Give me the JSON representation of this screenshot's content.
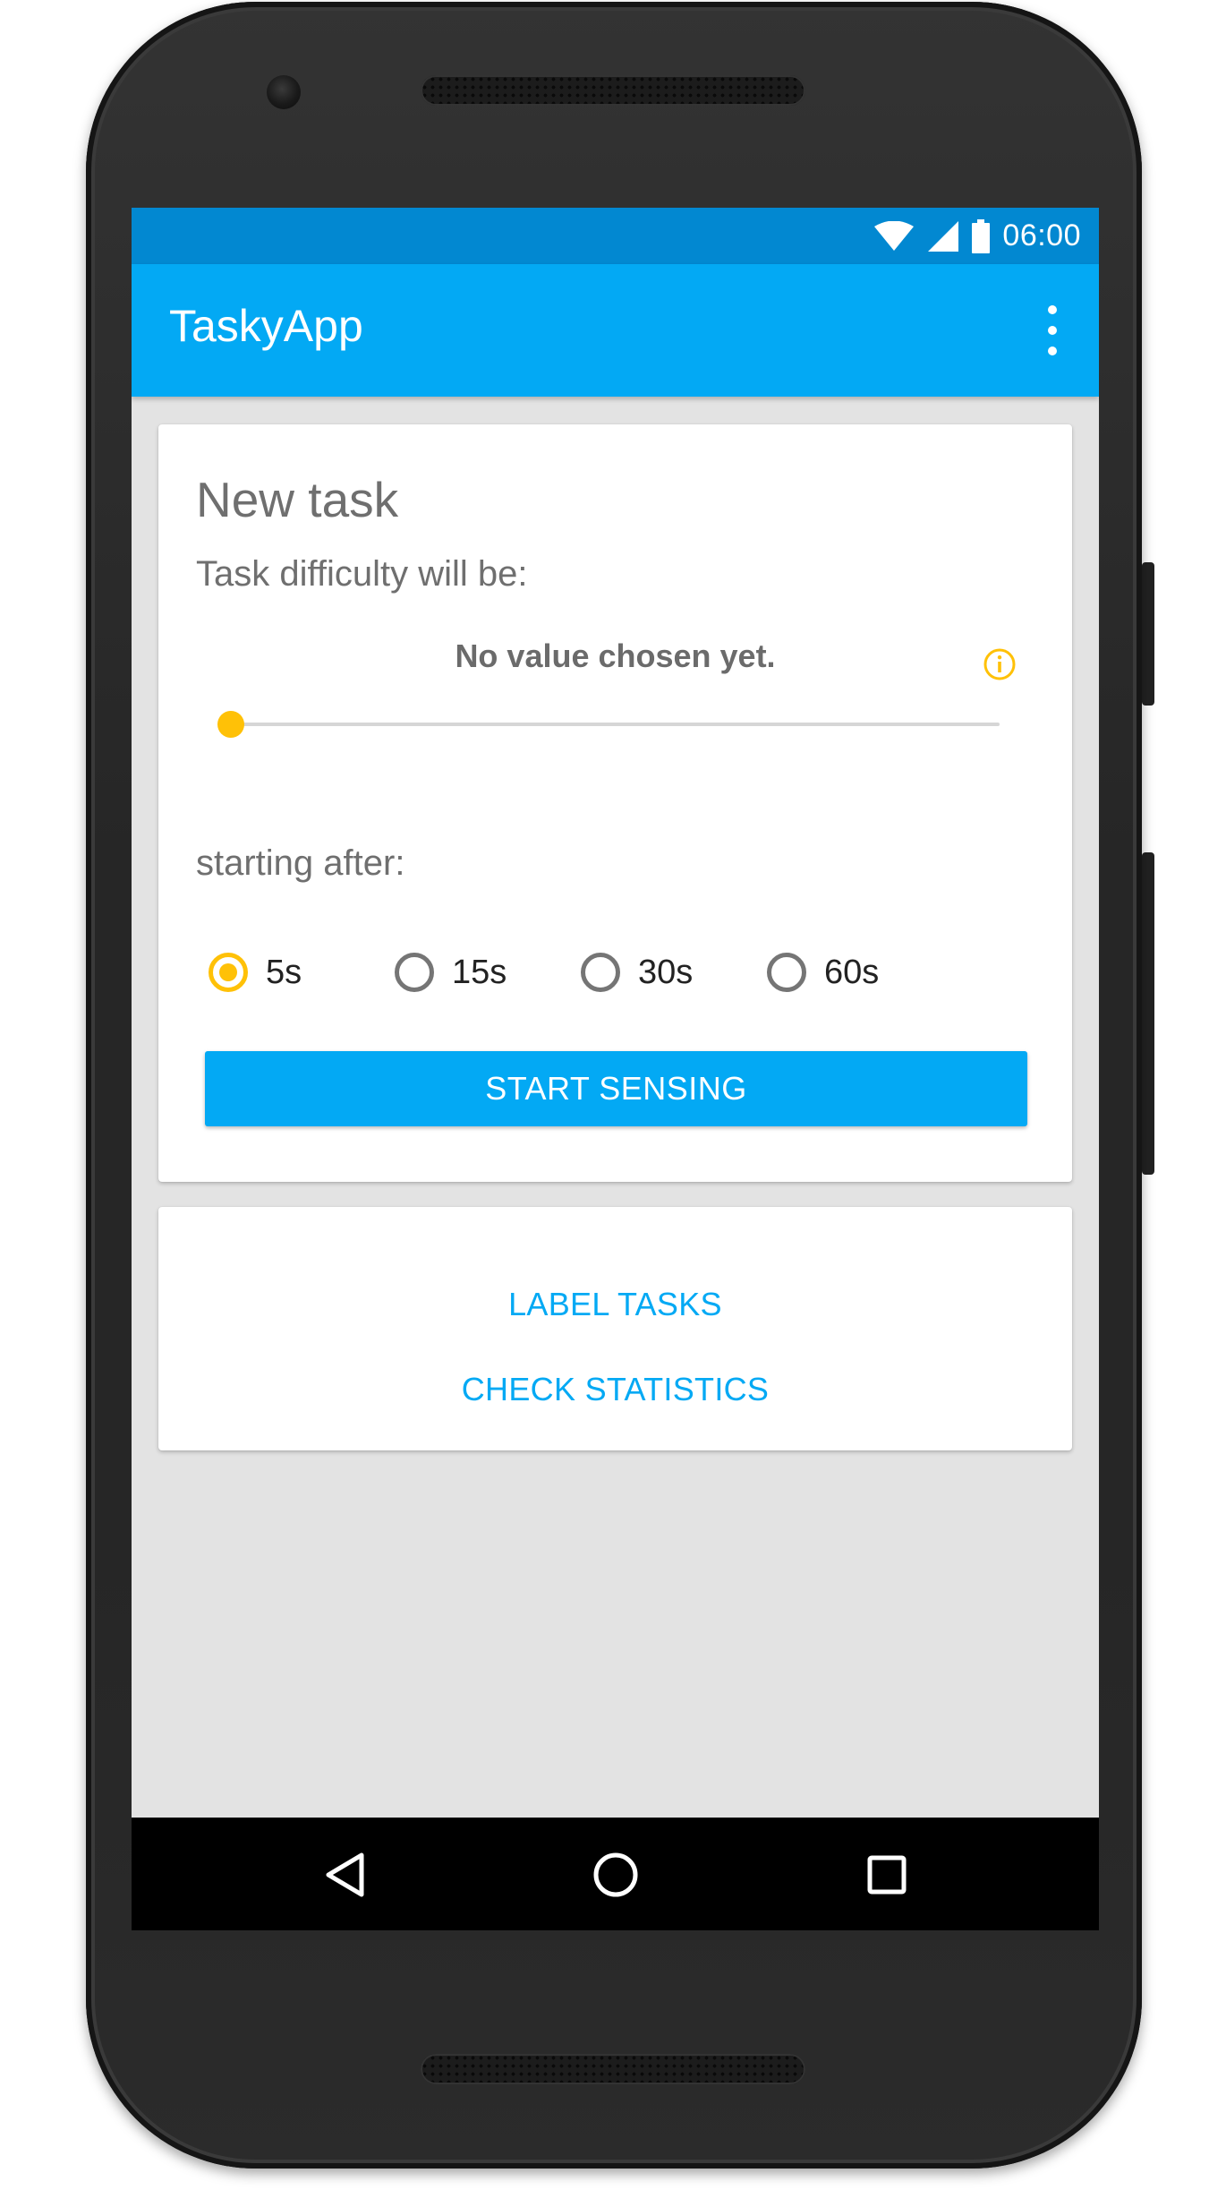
{
  "status_bar": {
    "time": "06:00",
    "icons": [
      "wifi-icon",
      "cell-signal-icon",
      "battery-icon"
    ]
  },
  "app_bar": {
    "title": "TaskyApp",
    "menu_icon": "more-vert-icon"
  },
  "task_card": {
    "title": "New task",
    "difficulty_label": "Task difficulty will be:",
    "difficulty_value": "No value chosen yet.",
    "info_icon": "info-icon",
    "slider_value": 0,
    "starting_label": "starting after:",
    "start_options": [
      {
        "label": "5s",
        "selected": true
      },
      {
        "label": "15s",
        "selected": false
      },
      {
        "label": "30s",
        "selected": false
      },
      {
        "label": "60s",
        "selected": false
      }
    ],
    "start_button": "START SENSING"
  },
  "actions_card": {
    "label_tasks": "LABEL TASKS",
    "check_statistics": "CHECK STATISTICS"
  },
  "nav_bar": {
    "icons": [
      "back-icon",
      "home-icon",
      "recents-icon"
    ]
  },
  "colors": {
    "primary": "#03a9f4",
    "primary_dark": "#0288d1",
    "accent": "#ffc107",
    "background": "#e3e3e3"
  }
}
